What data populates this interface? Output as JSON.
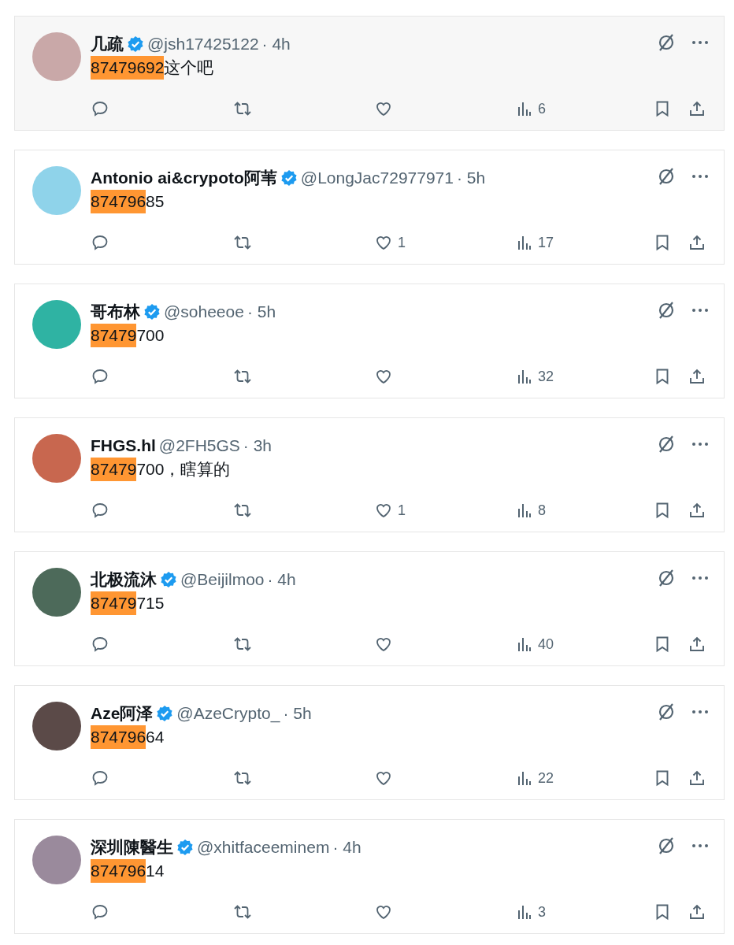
{
  "tweets": [
    {
      "name": "几疏",
      "verified": true,
      "handle": "@jsh17425122",
      "time": "· 4h",
      "text_highlight": "87479692",
      "text_rest": "这个吧",
      "views": "6",
      "hovered": true,
      "color": "#c9a8a8"
    },
    {
      "name": "Antonio ai&crypoto阿苇",
      "verified": true,
      "handle": "@LongJac72977971",
      "time": "· 5h",
      "text_highlight": "874796",
      "text_rest": "85",
      "likes": "1",
      "views": "17",
      "hovered": false,
      "color": "#8fd3ea"
    },
    {
      "name": "哥布林",
      "verified": true,
      "handle": "@soheeoe",
      "time": "· 5h",
      "text_highlight": "87479",
      "text_rest": "700",
      "views": "32",
      "hovered": false,
      "color": "#2fb3a3"
    },
    {
      "name": "FHGS.hl",
      "verified": false,
      "handle": "@2FH5GS",
      "time": "· 3h",
      "text_highlight": "87479",
      "text_rest": "700，瞎算的",
      "likes": "1",
      "views": "8",
      "hovered": false,
      "color": "#c8674f"
    },
    {
      "name": "北极流沐",
      "verified": true,
      "handle": "@Beijilmoo",
      "time": "· 4h",
      "text_highlight": "87479",
      "text_rest": "715",
      "views": "40",
      "hovered": false,
      "color": "#4d6a5a"
    },
    {
      "name": "Aze阿泽",
      "verified": true,
      "handle": "@AzeCrypto_",
      "time": "· 5h",
      "text_highlight": "874796",
      "text_rest": "64",
      "views": "22",
      "hovered": false,
      "color": "#5b4a48"
    },
    {
      "name": "深圳陳醫生",
      "verified": true,
      "handle": "@xhitfaceeminem",
      "time": "· 4h",
      "text_highlight": "874796",
      "text_rest": "14",
      "views": "3",
      "hovered": false,
      "color": "#9a8a9c"
    }
  ]
}
